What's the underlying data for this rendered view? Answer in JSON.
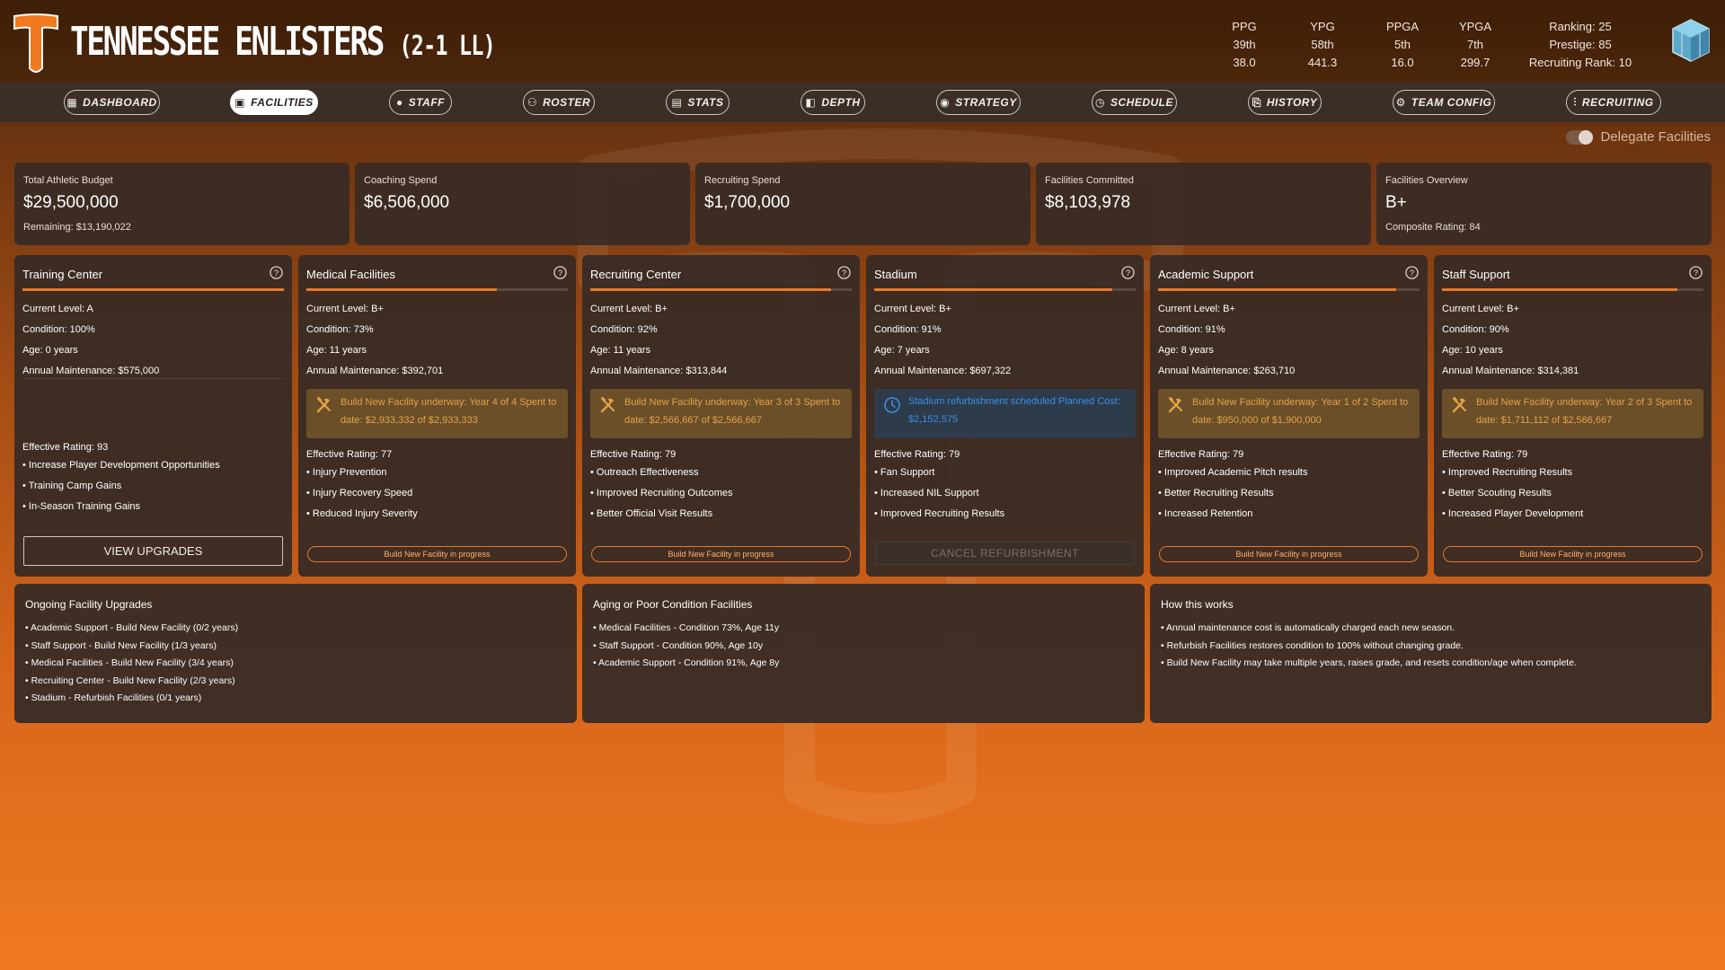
{
  "header": {
    "team_name": "TENNESSEE ENLISTERS",
    "record": "(2-1 LL)",
    "stats": [
      {
        "label": "PPG",
        "rank": "39th",
        "value": "38.0"
      },
      {
        "label": "YPG",
        "rank": "58th",
        "value": "441.3"
      },
      {
        "label": "PPGA",
        "rank": "5th",
        "value": "16.0"
      },
      {
        "label": "YPGA",
        "rank": "7th",
        "value": "299.7"
      }
    ],
    "ranking": "Ranking: 25",
    "prestige": "Prestige: 85",
    "recruiting_rank": "Recruiting Rank: 10"
  },
  "nav": [
    {
      "label": "DASHBOARD",
      "icon": "grid-icon"
    },
    {
      "label": "FACILITIES",
      "icon": "building-icon",
      "active": true
    },
    {
      "label": "STAFF",
      "icon": "person-icon"
    },
    {
      "label": "ROSTER",
      "icon": "people-icon"
    },
    {
      "label": "STATS",
      "icon": "chart-icon"
    },
    {
      "label": "DEPTH",
      "icon": "depth-icon"
    },
    {
      "label": "STRATEGY",
      "icon": "bulb-icon"
    },
    {
      "label": "SCHEDULE",
      "icon": "clock-icon"
    },
    {
      "label": "HISTORY",
      "icon": "history-icon"
    },
    {
      "label": "TEAM CONFIG",
      "icon": "gear-icon"
    },
    {
      "label": "RECRUITING",
      "icon": "sliders-icon"
    }
  ],
  "delegate": {
    "label": "Delegate Facilities",
    "enabled": false
  },
  "summary": [
    {
      "label": "Total Athletic Budget",
      "value": "$29,500,000",
      "sub": "Remaining: $13,190,022"
    },
    {
      "label": "Coaching Spend",
      "value": "$6,506,000",
      "sub": ""
    },
    {
      "label": "Recruiting Spend",
      "value": "$1,700,000",
      "sub": ""
    },
    {
      "label": "Facilities Committed",
      "value": "$8,103,978",
      "sub": ""
    },
    {
      "label": "Facilities Overview",
      "value": "B+",
      "sub": "Composite Rating: 84"
    }
  ],
  "facilities": [
    {
      "name": "Training Center",
      "level": "Current Level: A",
      "condition": "Condition: 100%",
      "condition_pct": 100,
      "age": "Age: 0 years",
      "maintenance": "Annual Maintenance: $575,000",
      "notice": "",
      "notice_type": "none",
      "effective": "Effective Rating: 93",
      "bullets": [
        "Increase Player Development Opportunities",
        "Training Camp Gains",
        "In-Season Training Gains"
      ],
      "button": "VIEW UPGRADES",
      "button_type": "big"
    },
    {
      "name": "Medical Facilities",
      "level": "Current Level: B+",
      "condition": "Condition: 73%",
      "condition_pct": 73,
      "age": "Age: 11 years",
      "maintenance": "Annual Maintenance: $392,701",
      "notice": "Build New Facility underway: Year 4 of 4 Spent to date: $2,933,332 of $2,933,333",
      "notice_type": "build",
      "effective": "Effective Rating: 77",
      "bullets": [
        "Injury Prevention",
        "Injury Recovery Speed",
        "Reduced Injury Severity"
      ],
      "button": "Build New Facility in progress",
      "button_type": "small"
    },
    {
      "name": "Recruiting Center",
      "level": "Current Level: B+",
      "condition": "Condition: 92%",
      "condition_pct": 92,
      "age": "Age: 11 years",
      "maintenance": "Annual Maintenance: $313,844",
      "notice": "Build New Facility underway: Year 3 of 3 Spent to date: $2,566,667 of $2,566,667",
      "notice_type": "build",
      "effective": "Effective Rating: 79",
      "bullets": [
        "Outreach Effectiveness",
        "Improved Recruiting Outcomes",
        "Better Official Visit Results"
      ],
      "button": "Build New Facility in progress",
      "button_type": "small"
    },
    {
      "name": "Stadium",
      "level": "Current Level: B+",
      "condition": "Condition: 91%",
      "condition_pct": 91,
      "age": "Age: 7 years",
      "maintenance": "Annual Maintenance: $697,322",
      "notice": "Stadium refurbishment scheduled Planned Cost: $2,152,575",
      "notice_type": "refurb",
      "effective": "Effective Rating: 79",
      "bullets": [
        "Fan Support",
        "Increased NIL Support",
        "Improved Recruiting Results"
      ],
      "button": "CANCEL REFURBISHMENT",
      "button_type": "disabled"
    },
    {
      "name": "Academic Support",
      "level": "Current Level: B+",
      "condition": "Condition: 91%",
      "condition_pct": 91,
      "age": "Age: 8 years",
      "maintenance": "Annual Maintenance: $263,710",
      "notice": "Build New Facility underway: Year 1 of 2 Spent to date: $950,000 of $1,900,000",
      "notice_type": "build",
      "effective": "Effective Rating: 79",
      "bullets": [
        "Improved Academic Pitch results",
        "Better Recruiting Results",
        "Increased Retention"
      ],
      "button": "Build New Facility in progress",
      "button_type": "small"
    },
    {
      "name": "Staff Support",
      "level": "Current Level: B+",
      "condition": "Condition: 90%",
      "condition_pct": 90,
      "age": "Age: 10 years",
      "maintenance": "Annual Maintenance: $314,381",
      "notice": "Build New Facility underway: Year 2 of 3 Spent to date: $1,711,112 of $2,566,667",
      "notice_type": "build",
      "effective": "Effective Rating: 79",
      "bullets": [
        "Improved Recruiting Results",
        "Better Scouting Results",
        "Increased Player Development"
      ],
      "button": "Build New Facility in progress",
      "button_type": "small"
    }
  ],
  "ongoing": {
    "title": "Ongoing Facility Upgrades",
    "items": [
      "Academic Support - Build New Facility (0/2 years)",
      "Staff Support - Build New Facility (1/3 years)",
      "Medical Facilities - Build New Facility (3/4 years)",
      "Recruiting Center - Build New Facility (2/3 years)",
      "Stadium - Refurbish Facilities (0/1 years)"
    ]
  },
  "aging": {
    "title": "Aging or Poor Condition Facilities",
    "items": [
      "Medical Facilities - Condition 73%, Age 11y",
      "Staff Support - Condition 90%, Age 10y",
      "Academic Support - Condition 91%, Age 8y"
    ]
  },
  "how": {
    "title": "How this works",
    "items": [
      "Annual maintenance cost is automatically charged each new season.",
      "Refurbish Facilities restores condition to 100% without changing grade.",
      "Build New Facility may take multiple years, raises grade, and resets condition/age when complete."
    ]
  },
  "colors": {
    "accent": "#e57a2c",
    "notice_bg": "#6a4f28",
    "notice_text": "#e3a24a",
    "refurb_text": "#3b8fe6",
    "panel": "#3a2c24"
  }
}
